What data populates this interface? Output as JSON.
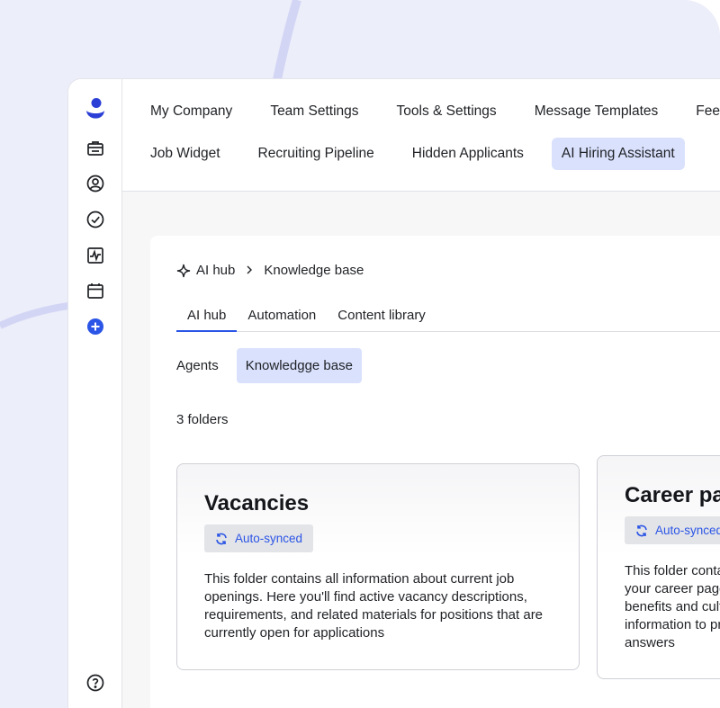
{
  "colors": {
    "accent": "#2b55e6",
    "active_bg": "#d9e1fd",
    "backdrop": "#eceefa"
  },
  "sidebar": {
    "icons": [
      "brand-logo-icon",
      "briefcase-icon",
      "user-circle-icon",
      "check-circle-icon",
      "activity-chart-icon",
      "calendar-icon",
      "add-circle-icon",
      "help-icon"
    ]
  },
  "topnav": {
    "row1": [
      "My Company",
      "Team Settings",
      "Tools & Settings",
      "Message Templates",
      "Feedback"
    ],
    "row2": [
      "Job Widget",
      "Recruiting Pipeline",
      "Hidden Applicants",
      "AI Hiring Assistant"
    ],
    "active": "AI Hiring Assistant"
  },
  "breadcrumb": {
    "root": "AI hub",
    "current": "Knowledge base"
  },
  "tabs": [
    "AI hub",
    "Automation",
    "Content library"
  ],
  "active_tab": "AI hub",
  "subtabs": [
    "Agents",
    "Knowledgge base"
  ],
  "active_subtab": "Knowledgge base",
  "folders_count": "3 folders",
  "cards": [
    {
      "title": "Vacancies",
      "badge": "Auto-synced",
      "description": "This folder contains all information about current job openings. Here you'll find active vacancy descriptions, requirements, and related materials for positions that are currently open for applications"
    },
    {
      "title": "Career page",
      "badge": "Auto-synced",
      "description": "This folder contains information from your career page, company values, benefits and culture. AI uses this information to provide accurate answers"
    }
  ]
}
